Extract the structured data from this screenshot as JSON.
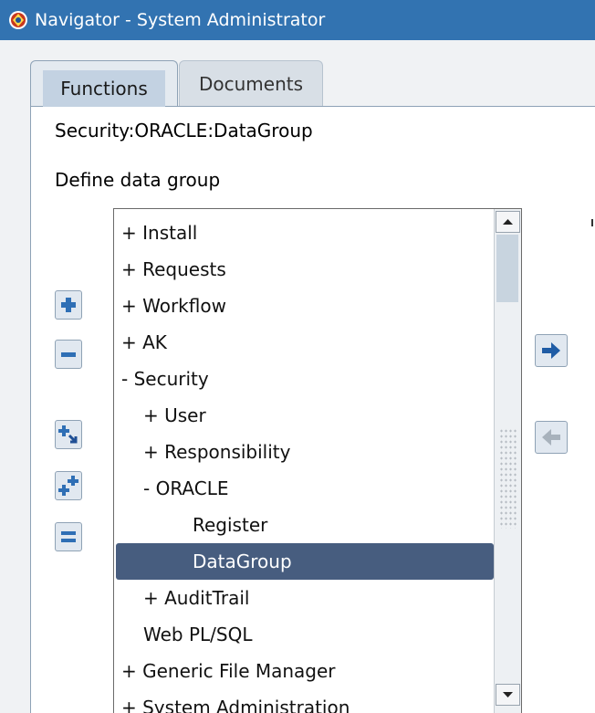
{
  "window": {
    "title": "Navigator - System Administrator"
  },
  "tabs": [
    {
      "label": "Functions",
      "selected": true
    },
    {
      "label": "Documents",
      "selected": false
    }
  ],
  "header": {
    "path": "Security:ORACLE:DataGroup",
    "description": "Define data group"
  },
  "tree": {
    "items": [
      {
        "label": "+  Install",
        "depth": 0,
        "selected": false
      },
      {
        "label": "+  Requests",
        "depth": 0,
        "selected": false
      },
      {
        "label": "+  Workflow",
        "depth": 0,
        "selected": false
      },
      {
        "label": "+  AK",
        "depth": 0,
        "selected": false
      },
      {
        "label": "-  Security",
        "depth": 0,
        "selected": false
      },
      {
        "label": "+  User",
        "depth": 1,
        "selected": false
      },
      {
        "label": "+  Responsibility",
        "depth": 1,
        "selected": false
      },
      {
        "label": "-  ORACLE",
        "depth": 1,
        "selected": false
      },
      {
        "label": "Register",
        "depth": 2,
        "selected": false
      },
      {
        "label": "DataGroup",
        "depth": 2,
        "selected": true
      },
      {
        "label": "+  AuditTrail",
        "depth": 1,
        "selected": false
      },
      {
        "label": "Web PL/SQL",
        "depth": 1,
        "selected": false
      },
      {
        "label": "+  Generic File Manager",
        "depth": 0,
        "selected": false
      },
      {
        "label": "+  System Administration",
        "depth": 0,
        "selected": false
      }
    ]
  },
  "buttons": {
    "expand_icon": "plus-icon",
    "collapse_icon": "minus-icon",
    "expand_branch_icon": "expand-branch-icon",
    "expand_all_icon": "expand-all-icon",
    "collapse_all_icon": "collapse-all-icon",
    "add_to_top_ten_icon": "arrow-right-icon",
    "remove_from_top_ten_icon": "arrow-left-icon"
  },
  "colors": {
    "titlebar": "#3273b1",
    "selection": "#475d7f",
    "tab_active": "#c3d2e2"
  }
}
